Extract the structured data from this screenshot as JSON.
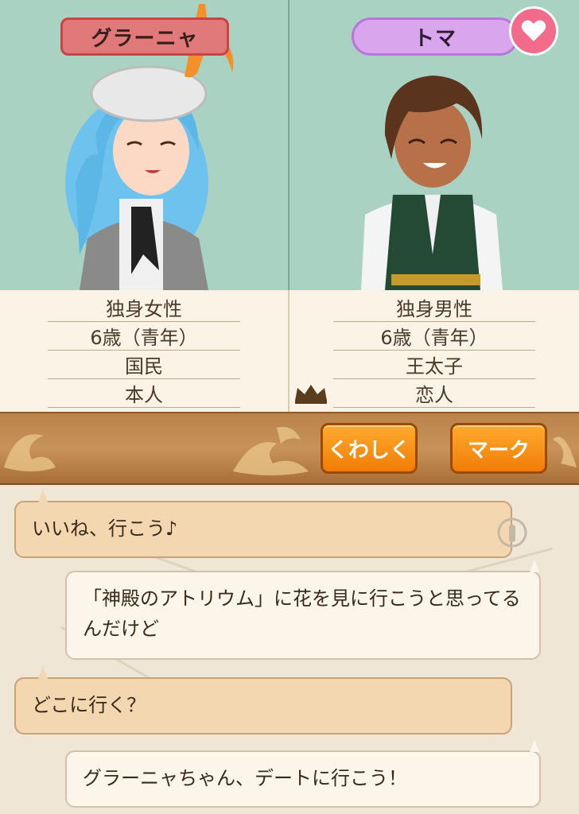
{
  "characters": {
    "left": {
      "name": "グラーニャ",
      "status": "独身女性",
      "age": "6歳（青年）",
      "rank": "国民",
      "relation": "本人"
    },
    "right": {
      "name": "トマ",
      "status": "独身男性",
      "age": "6歳（青年）",
      "rank": "王太子",
      "relation": "恋人"
    }
  },
  "buttons": {
    "detail": "くわしく",
    "mark": "マーク"
  },
  "messages": [
    {
      "side": "in",
      "text": "いいね、行こう♪"
    },
    {
      "side": "out",
      "text": "「神殿のアトリウム」に花を見に行こうと思ってるんだけど"
    },
    {
      "side": "in",
      "text": "どこに行く？"
    },
    {
      "side": "out",
      "text": "グラーニャちゃん、デートに行こう！"
    }
  ],
  "colors": {
    "portrait_bg": "#a9d2c3",
    "female_plate": "#e07a7a",
    "male_plate": "#d9a6ee",
    "button_orange": "#f58e14",
    "bar_brown": "#c8935a"
  },
  "icons": {
    "heart": "heart-icon",
    "crown": "crown-icon",
    "music_note": "music-note-icon",
    "tap": "tap-hand-icon"
  }
}
